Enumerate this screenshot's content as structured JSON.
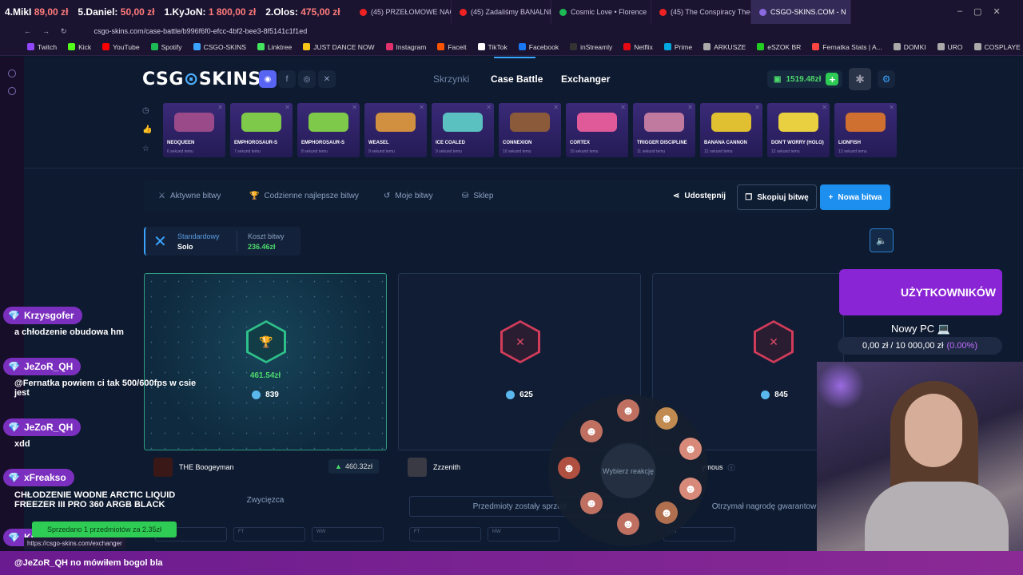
{
  "browser": {
    "ticker": [
      {
        "name": "4.MikI",
        "score": "89,00 zł"
      },
      {
        "name": "5.Daniel:",
        "score": "50,00 zł"
      },
      {
        "name": "1.KyJoN:",
        "score": "1 800,00 zł"
      },
      {
        "name": "2.Olos:",
        "score": "475,00 zł"
      }
    ],
    "tabs": [
      {
        "label": "(45) PRZEŁOMOWE NAGR",
        "icon": "youtube"
      },
      {
        "label": "(45) Zadaliśmy BANALNE",
        "icon": "youtube"
      },
      {
        "label": "Cosmic Love • Florence",
        "icon": "spotify"
      },
      {
        "label": "(45) The Conspiracy Theo",
        "icon": "youtube"
      },
      {
        "label": "CSGO-SKINS.COM - N",
        "icon": "site",
        "active": true
      }
    ],
    "url": "csgo-skins.com/case-battle/b996f6f0-efcc-4bf2-bee3-8f5141c1f1ed",
    "bookmarks": [
      "Twitch",
      "Kick",
      "YouTube",
      "Spotify",
      "CSGO-SKINS",
      "Linktree",
      "JUST DANCE NOW",
      "Instagram",
      "Faceit",
      "TikTok",
      "Facebook",
      "inStreamly",
      "Netflix",
      "Prime",
      "ARKUSZE",
      "eSZOK BR",
      "Fernatka Stats | A...",
      "DOMKI",
      "URO",
      "COSPLAYE"
    ]
  },
  "site": {
    "logo_left": "CSG",
    "logo_right": "SKINS",
    "nav": {
      "cases": "Skrzynki",
      "battle": "Case Battle",
      "exchanger": "Exchanger"
    },
    "balance": "1519.48zł",
    "live_drops": [
      {
        "name": "NEOQUEEN",
        "time": "6 sekund temu",
        "color": "#9a4a88"
      },
      {
        "name": "EMPHOROSAUR-S",
        "time": "7 sekund temu",
        "color": "#7ec84a"
      },
      {
        "name": "EMPHOROSAUR-S",
        "time": "8 sekund temu",
        "color": "#7ec84a"
      },
      {
        "name": "WEASEL",
        "time": "9 sekund temu",
        "color": "#d09040"
      },
      {
        "name": "ICE COALED",
        "time": "9 sekund temu",
        "color": "#5ac0c0"
      },
      {
        "name": "CONNEXION",
        "time": "10 sekund temu",
        "color": "#8a5a3a"
      },
      {
        "name": "CORTEX",
        "time": "10 sekund temu",
        "color": "#e05a9a"
      },
      {
        "name": "TRIGGER DISCIPLINE",
        "time": "11 sekund temu",
        "color": "#c07aa0"
      },
      {
        "name": "BANANA CANNON",
        "time": "12 sekund temu",
        "color": "#e0c030"
      },
      {
        "name": "DON'T WORRY (HOLO)",
        "time": "12 sekund temu",
        "color": "#e8d040"
      },
      {
        "name": "LIONFISH",
        "time": "13 sekund temu",
        "color": "#d07030"
      }
    ],
    "panel": {
      "active": "Aktywne bitwy",
      "daily": "Codzienne najlepsze bitwy",
      "mine": "Moje bitwy",
      "shop": "Sklep",
      "share": "Udostępnij",
      "copy": "Skopiuj bitwę",
      "new": "Nowa bitwa"
    },
    "mode": {
      "label": "Standardowy",
      "value": "Solo",
      "cost_label": "Koszt bitwy",
      "cost": "236.46zł"
    },
    "players": [
      {
        "name": "THE Boogeyman",
        "coins": "839",
        "win": "461.54zł",
        "amount": "460.32zł",
        "status": "Zwycięzca",
        "winner": true,
        "slots": [
          "FT",
          "FT",
          "WW"
        ]
      },
      {
        "name": "Zzzenith",
        "coins": "625",
        "status": "Przedmioty zostały sprzed",
        "slots": [
          "FT",
          "MW"
        ]
      },
      {
        "name": "ymous",
        "coins": "845",
        "status": "Otrzymał nagrodę gwarantow",
        "slots": [
          "MW"
        ]
      }
    ],
    "reaction_prompt": "Wybierz reakcję"
  },
  "stream": {
    "chat": [
      {
        "user": "Krzysgofer",
        "text": "a chłodzenie obudowa hm",
        "color": "#7b2fbf"
      },
      {
        "user": "JeZoR_QH",
        "text": "@Fernatka powiem ci tak 500/600fps w csie jest",
        "color": "#7b2fbf"
      },
      {
        "user": "JeZoR_QH",
        "text": "xdd",
        "color": "#7b2fbf"
      },
      {
        "user": "xFreakso",
        "text": "CHŁODZENIE WODNE ARCTIC LIQUID FREEZER III PRO 360 ARGB BLACK",
        "color": "#7b2fbf"
      },
      {
        "user": "Krzysgofer",
        "text": "@JeZoR_QH no mówiłem bogol bla",
        "color": "#7b2fbf"
      }
    ],
    "sold_banner": "Sprzedano 1 przedmiotów za 2.35zł",
    "hover_url": "https://csgo-skins.com/exchanger",
    "goal_header": "UŻYTKOWNIKÓW",
    "goal_title": "Nowy PC 💻",
    "goal_progress": "0,00 zł / 10 000,00 zł",
    "goal_percent": "(0.00%)"
  }
}
